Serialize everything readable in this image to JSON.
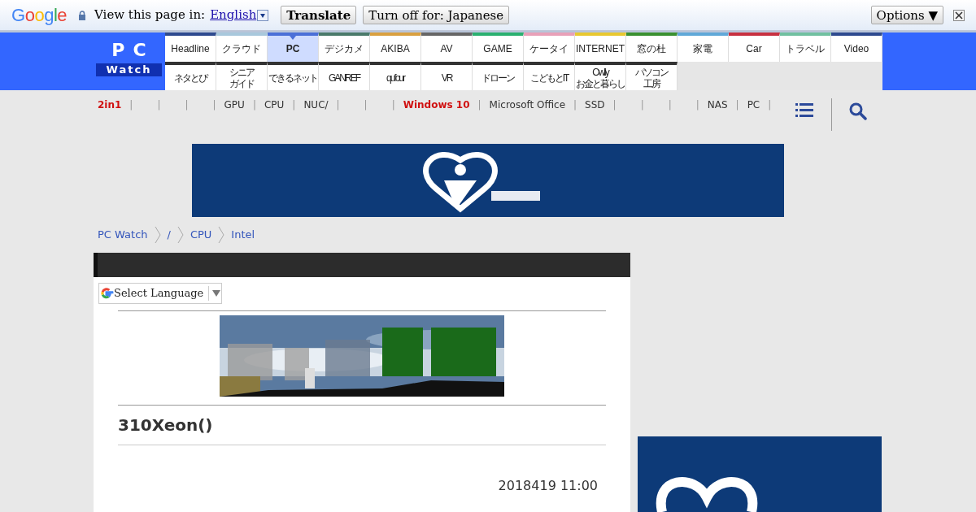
{
  "translate_bar": {
    "logo": "Google",
    "prompt": "View this page in:",
    "language": "English",
    "translate_button": "Translate",
    "turn_off_button": "Turn off for: Japanese",
    "options_button": "Options ▼"
  },
  "site_logo": {
    "line_1": "PC",
    "line_2": "Watch"
  },
  "nav_tabs": [
    {
      "label": "Headline",
      "color": "#2e4a8f",
      "selected": false
    },
    {
      "label": "クラウド",
      "color": "#a8c8dc",
      "selected": false
    },
    {
      "label": "PC",
      "color": "#4a6fd8",
      "selected": true
    },
    {
      "label": "デジカメ",
      "color": "#4a7a6a",
      "selected": false
    },
    {
      "label": "AKIBA",
      "color": "#d9a040",
      "selected": false
    },
    {
      "label": "AV",
      "color": "#666666",
      "selected": false
    },
    {
      "label": "GAME",
      "color": "#2ab070",
      "selected": false
    },
    {
      "label": "ケータイ",
      "color": "#e8a0b8",
      "selected": false
    },
    {
      "label": "INTERNET",
      "color": "#e8c830",
      "selected": false
    },
    {
      "label": "窓の杜",
      "color": "#3a9030",
      "selected": false
    },
    {
      "label": "家電",
      "color": "#60a8d8",
      "selected": false
    },
    {
      "label": "Car",
      "color": "#c83040",
      "selected": false
    },
    {
      "label": "トラベル",
      "color": "#70c0a0",
      "selected": false
    },
    {
      "label": "Video",
      "color": "#2e4a8f",
      "selected": false
    }
  ],
  "sub_tabs": [
    {
      "lines": [
        "ネタとぴ"
      ]
    },
    {
      "lines": [
        "シニア",
        "ガイド"
      ]
    },
    {
      "lines": [
        "できるネット"
      ]
    },
    {
      "lines": [
        "GANREF"
      ]
    },
    {
      "lines": [
        "qufour"
      ]
    },
    {
      "lines": [
        "VR"
      ]
    },
    {
      "lines": [
        "ドローン"
      ]
    },
    {
      "lines": [
        "こどもとIT"
      ]
    },
    {
      "lines": [
        "Owlly",
        "お金と暮らし"
      ]
    },
    {
      "lines": [
        "パソコン",
        "工房"
      ]
    }
  ],
  "tag_separator": "|",
  "topic_tags": [
    {
      "kind": "tag",
      "label": "2in1",
      "hot": true
    },
    {
      "kind": "blank"
    },
    {
      "kind": "blank"
    },
    {
      "kind": "blank"
    },
    {
      "kind": "tag",
      "label": "GPU",
      "hot": false
    },
    {
      "kind": "tag",
      "label": "CPU",
      "hot": false
    },
    {
      "kind": "tag",
      "label": "NUC/",
      "hot": false
    },
    {
      "kind": "blank"
    },
    {
      "kind": "blank"
    },
    {
      "kind": "tag",
      "label": "Windows 10",
      "hot": true
    },
    {
      "kind": "tag",
      "label": "Microsoft Office",
      "hot": false
    },
    {
      "kind": "tag",
      "label": "SSD",
      "hot": false
    },
    {
      "kind": "blank"
    },
    {
      "kind": "blank"
    },
    {
      "kind": "blank"
    },
    {
      "kind": "tag",
      "label": "NAS",
      "hot": false
    },
    {
      "kind": "tag",
      "label": "PC",
      "hot": false
    }
  ],
  "breadcrumb": [
    "PC Watch",
    "/",
    "CPU",
    "Intel"
  ],
  "language_select": "Select Language",
  "article": {
    "title": "310Xeon()",
    "date": "2018419 11:00"
  }
}
